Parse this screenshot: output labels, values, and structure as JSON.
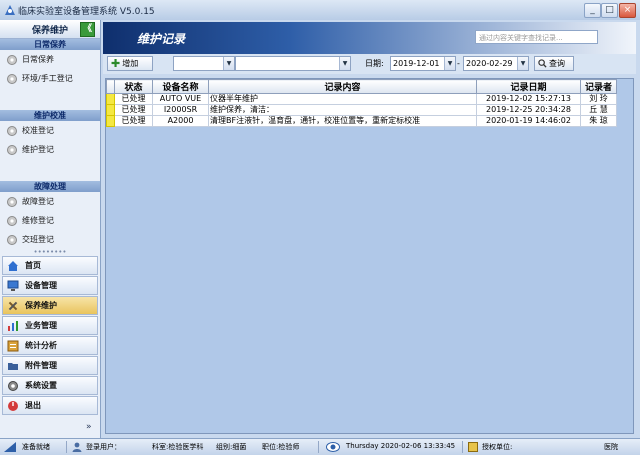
{
  "window": {
    "title": "临床实验室设备管理系统  V5.0.15",
    "min_label": "_",
    "max_label": "□",
    "close_label": "×"
  },
  "sidebar": {
    "header": "保养维护",
    "collapse_label": "《",
    "groups": [
      {
        "title": "日常保养",
        "items": [
          "日常保养",
          "环境/手工登记"
        ]
      },
      {
        "title": "维护校准",
        "items": [
          "校准登记",
          "维护登记"
        ]
      },
      {
        "title": "故障处理",
        "items": [
          "故障登记",
          "维修登记",
          "交班登记"
        ]
      }
    ],
    "nav": [
      {
        "label": "首页",
        "icon": "home-icon"
      },
      {
        "label": "设备管理",
        "icon": "monitor-icon"
      },
      {
        "label": "保养维护",
        "icon": "tools-icon",
        "active": true
      },
      {
        "label": "业务管理",
        "icon": "chart-icon"
      },
      {
        "label": "统计分析",
        "icon": "stats-icon"
      },
      {
        "label": "附件管理",
        "icon": "folder-icon"
      },
      {
        "label": "系统设置",
        "icon": "settings-icon"
      },
      {
        "label": "退出",
        "icon": "power-icon"
      }
    ],
    "more_label": "»"
  },
  "page": {
    "title": "维护记录",
    "search_placeholder": "通过内容关键字查找记录..."
  },
  "toolbar": {
    "add_label": "增加",
    "combo1_value": "",
    "combo2_value": "",
    "date_label": "日期:",
    "date_from": "2019-12-01",
    "date_sep": "-",
    "date_to": "2020-02-29",
    "query_label": "查询"
  },
  "table": {
    "columns": [
      "状态",
      "设备名称",
      "记录内容",
      "记录日期",
      "记录者"
    ],
    "rows": [
      [
        "已处理",
        "AUTO VUE",
        "仪器半年维护",
        "2019-12-02 15:27:13",
        "刘  玲"
      ],
      [
        "已处理",
        "I2000SR",
        "维护保养，清洁：",
        "2019-12-25 20:34:28",
        "丘  慧"
      ],
      [
        "已处理",
        "A2000",
        "清理BF注液针，温育盘，通针，校准位置等，重新定标校准",
        "2020-01-19 14:46:02",
        "朱  琼"
      ]
    ]
  },
  "status": {
    "ready": "准备就绪",
    "user": "登录用户：",
    "dept": "科室:检验医学科",
    "group": "组别:细菌",
    "role": "职位:检验师",
    "datetime": "Thursday  2020-02-06 13:33:45",
    "org": "授权单位:",
    "hospital": "医院"
  },
  "colors": {
    "accent": "#2e5ea8",
    "indicator": "#f4e842"
  }
}
